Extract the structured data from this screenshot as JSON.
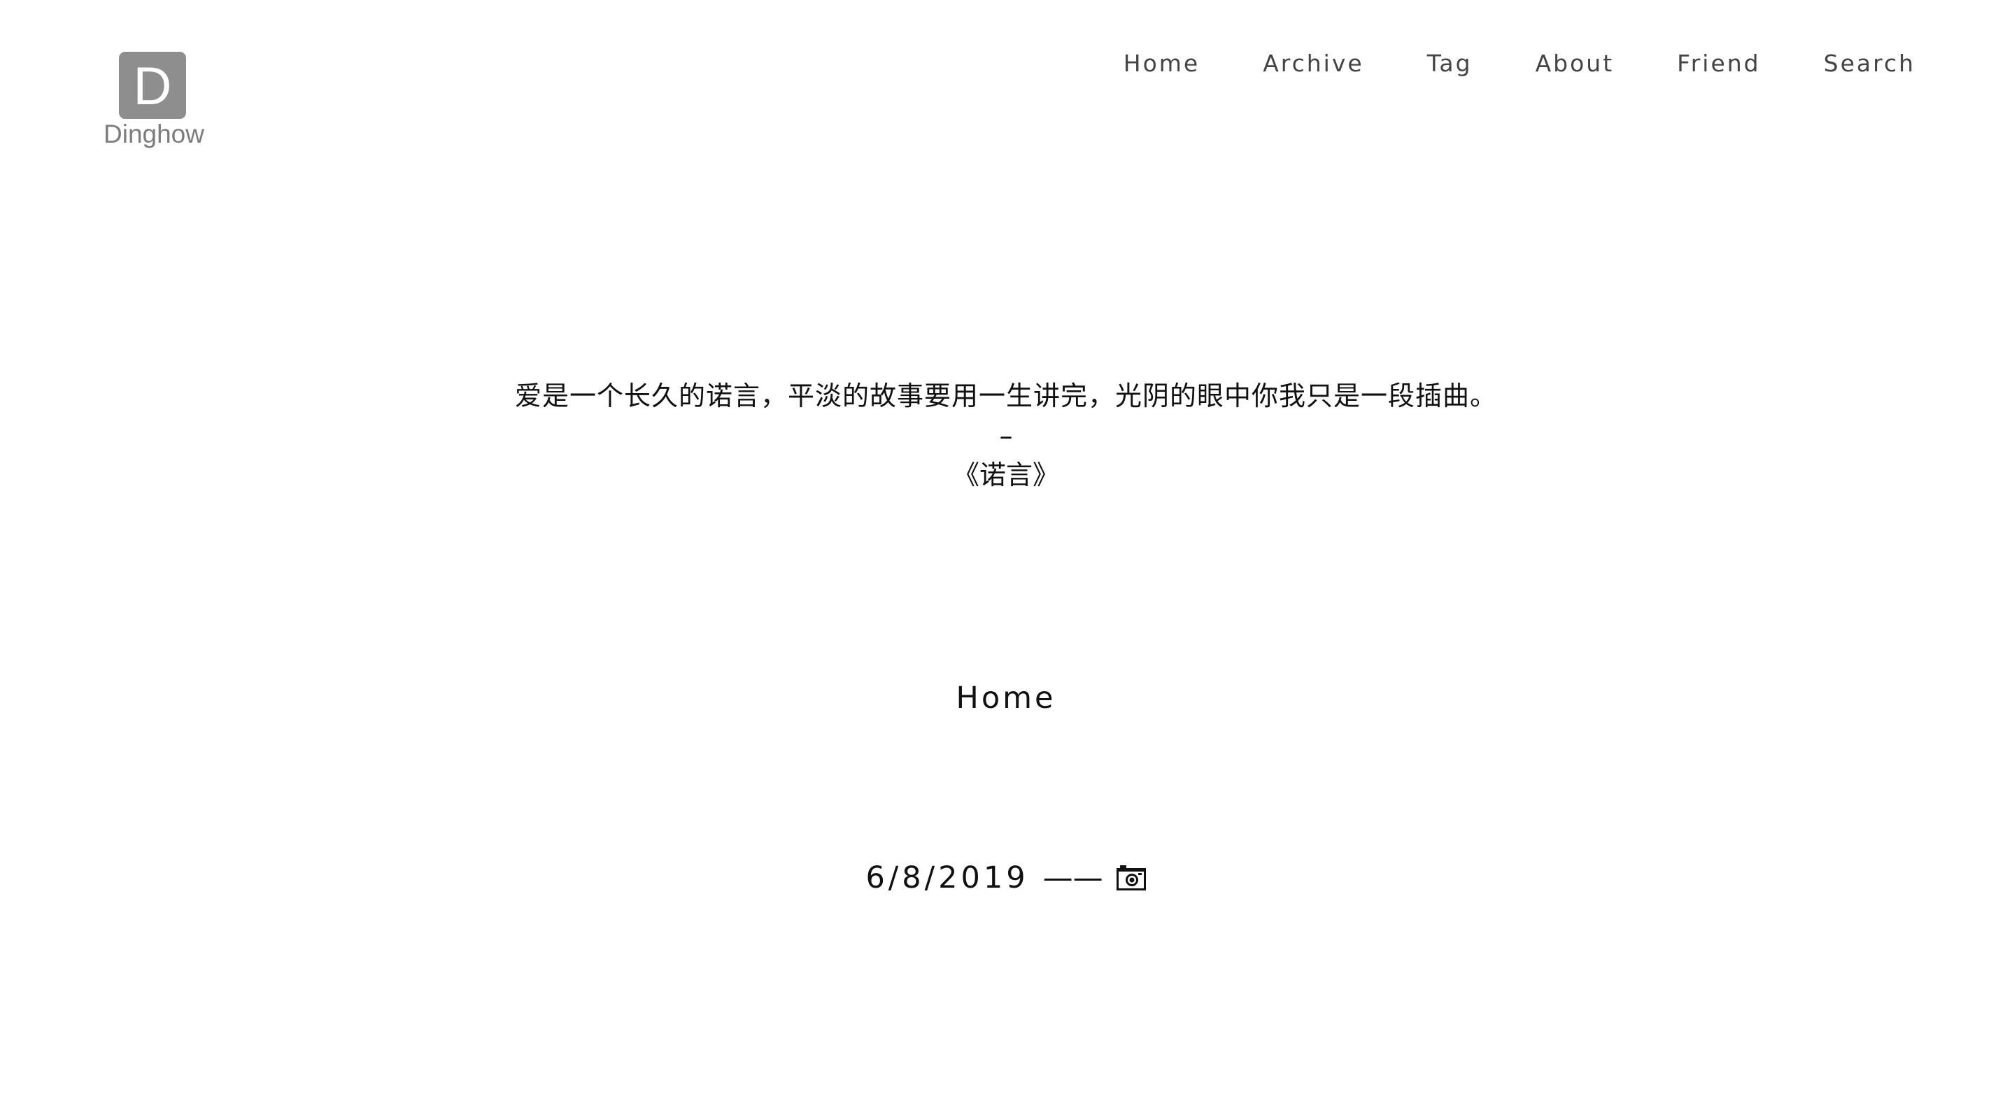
{
  "site": {
    "logo_letter": "D",
    "logo_text": "Dinghow"
  },
  "nav": {
    "items": [
      {
        "label": "Home"
      },
      {
        "label": "Archive"
      },
      {
        "label": "Tag"
      },
      {
        "label": "About"
      },
      {
        "label": "Friend"
      },
      {
        "label": "Search"
      }
    ]
  },
  "quote": {
    "text": "爱是一个长久的诺言，平淡的故事要用一生讲完，光阴的眼中你我只是一段插曲。",
    "dash": "–",
    "source": "《诺言》"
  },
  "section": {
    "title": "Home"
  },
  "posts": [
    {
      "date": "6/8/2019",
      "separator": "——",
      "icon": "camera-icon"
    }
  ]
}
